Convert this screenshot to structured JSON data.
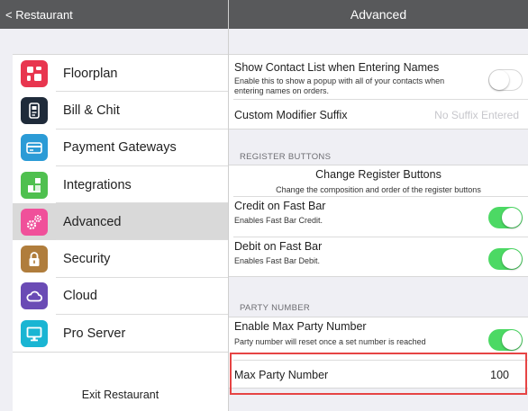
{
  "header": {
    "back_label": "< Restaurant",
    "title": "Advanced"
  },
  "sidebar": {
    "items": [
      {
        "label": "Floorplan",
        "icon": "floorplan-icon",
        "color": "#e8364f",
        "selected": false
      },
      {
        "label": "Bill & Chit",
        "icon": "receipt-icon",
        "color": "#1f2b3a",
        "selected": false
      },
      {
        "label": "Payment Gateways",
        "icon": "credit-card-icon",
        "color": "#2b9bd6",
        "selected": false
      },
      {
        "label": "Integrations",
        "icon": "integrations-icon",
        "color": "#4fc04f",
        "selected": false
      },
      {
        "label": "Advanced",
        "icon": "gears-icon",
        "color": "#f0509a",
        "selected": true
      },
      {
        "label": "Security",
        "icon": "lock-icon",
        "color": "#b07d3c",
        "selected": false
      },
      {
        "label": "Cloud",
        "icon": "cloud-icon",
        "color": "#6a4bb5",
        "selected": false
      },
      {
        "label": "Pro Server",
        "icon": "monitor-icon",
        "color": "#1ab5d3",
        "selected": false
      }
    ],
    "exit_label": "Exit Restaurant"
  },
  "settings": {
    "contact_list": {
      "title": "Show Contact List when Entering Names",
      "description": "Enable this to show a popup with all of your contacts when entering names on orders.",
      "enabled": false
    },
    "modifier_suffix": {
      "title": "Custom Modifier Suffix",
      "placeholder": "No Suffix Entered"
    },
    "register_buttons": {
      "section_header": "REGISTER BUTTONS",
      "change_title": "Change Register Buttons",
      "change_description": "Change the composition and order of the register buttons",
      "credit_title": "Credit on Fast Bar",
      "credit_description": "Enables Fast Bar Credit.",
      "credit_enabled": true,
      "debit_title": "Debit on Fast Bar",
      "debit_description": "Enables Fast Bar Debit.",
      "debit_enabled": true
    },
    "party_number": {
      "section_header": "PARTY NUMBER",
      "enable_title": "Enable Max Party Number",
      "enable_description": "Party number will reset once a set number is reached",
      "enabled": true,
      "max_title": "Max Party Number",
      "max_value": "100"
    }
  },
  "colors": {
    "header_bg": "#58595b",
    "toggle_on": "#4cd964",
    "highlight": "#e64444"
  }
}
